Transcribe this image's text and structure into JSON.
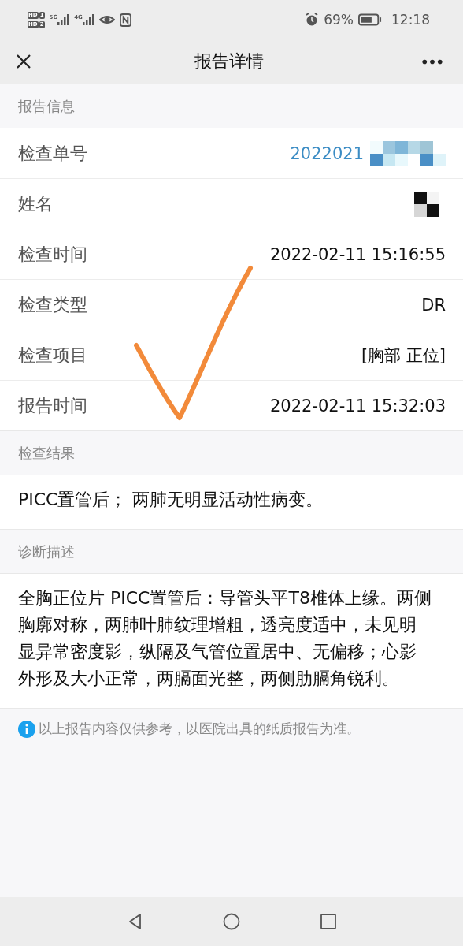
{
  "status_bar": {
    "sims": [
      {
        "badge": "HD",
        "slot": "1"
      },
      {
        "badge": "HD",
        "slot": "2"
      }
    ],
    "networks": [
      "5G",
      "4G"
    ],
    "battery": "69%",
    "time": "12:18"
  },
  "nav": {
    "title": "报告详情"
  },
  "sections": [
    {
      "kind": "fields",
      "title": "报告信息",
      "rows": [
        {
          "label": "检查单号",
          "value": "2022021",
          "kind": "link",
          "masked": true
        },
        {
          "label": "姓名",
          "kind": "plain",
          "masked": true
        },
        {
          "label": "检查时间",
          "value": "2022-02-11 15:16:55",
          "kind": "plain",
          "masked": false
        },
        {
          "label": "检查类型",
          "value": "DR",
          "kind": "plain",
          "masked": false
        },
        {
          "label": "检查项目",
          "value": "[胸部 正位]",
          "kind": "plain",
          "masked": false
        },
        {
          "label": "报告时间",
          "value": "2022-02-11 15:32:03",
          "kind": "plain",
          "masked": false
        }
      ]
    },
    {
      "kind": "text",
      "title": "检查结果",
      "text": "PICC置管后；  两肺无明显活动性病变。"
    },
    {
      "kind": "text",
      "title": "诊断描述",
      "text": "全胸正位片 PICC置管后：导管头平T8椎体上缘。两侧胸廓对称，两肺叶肺纹理增粗，透亮度适中，未见明显异常密度影，纵隔及气管位置居中、无偏移；心影外形及大小正常，两膈面光整，两侧肋膈角锐利。"
    }
  ],
  "notice": "以上报告内容仅供参考，以医院出具的纸质报告为准。",
  "annotation": {
    "kind": "checkmark",
    "color": "#f28a3a"
  }
}
